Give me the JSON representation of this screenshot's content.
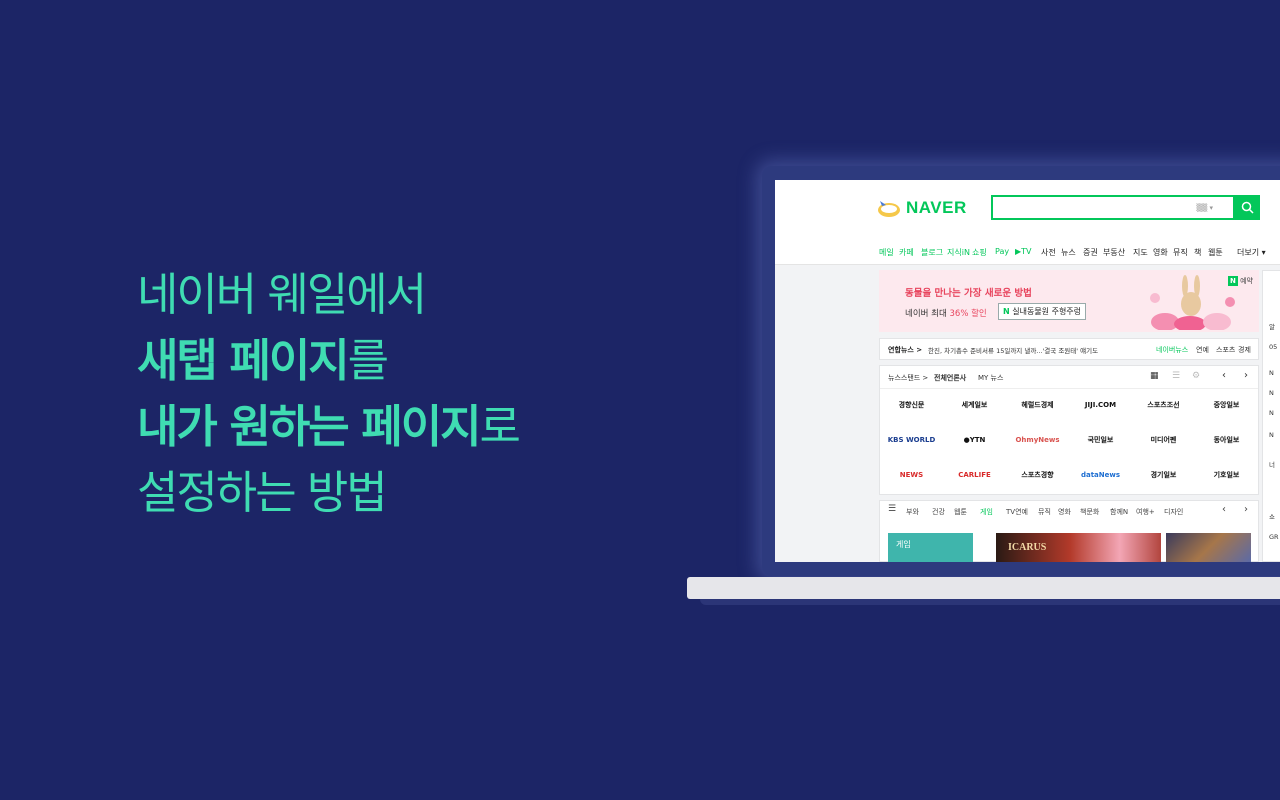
{
  "hero": {
    "line1": "네이버 웨일에서",
    "line2_bold": "새탭 페이지",
    "line2_rest": "를",
    "line3_bold": "내가 원하는 페이지",
    "line3_rest": "로",
    "line4": "설정하는 방법"
  },
  "naver": {
    "logo": "NAVER",
    "search_kb": "▒▒ ▾",
    "menu": [
      {
        "label": "메일",
        "green": true
      },
      {
        "label": "카페",
        "green": true
      },
      {
        "label": "블로그",
        "green": true
      },
      {
        "label": "지식iN",
        "green": true
      },
      {
        "label": "쇼핑",
        "green": true
      },
      {
        "label": "Pay",
        "green": true
      },
      {
        "label": "▶TV",
        "green": true
      },
      {
        "label": "사전",
        "green": false
      },
      {
        "label": "뉴스",
        "green": false
      },
      {
        "label": "증권",
        "green": false
      },
      {
        "label": "부동산",
        "green": false
      },
      {
        "label": "지도",
        "green": false
      },
      {
        "label": "영화",
        "green": false
      },
      {
        "label": "뮤직",
        "green": false
      },
      {
        "label": "책",
        "green": false
      },
      {
        "label": "웹툰",
        "green": false
      },
      {
        "label": "더보기 ▾",
        "green": false
      }
    ],
    "banner": {
      "title": "동물을 만나는 가장 새로운 방법",
      "sub_pre": "네이버 최대 ",
      "sub_pct": "36% 할인",
      "cta_n": "N",
      "cta": " 실내동물원 주형주렁",
      "ad_n": "N",
      "ad": " 예약"
    },
    "ticker": {
      "source": "연합뉴스 >",
      "headline": "한진, 차기총수 준비서류 15일까지 낼까...'결국 조원태' 얘기도",
      "links": [
        {
          "label": "네이버뉴스",
          "green": true
        },
        {
          "label": "연예",
          "green": false
        },
        {
          "label": "스포츠",
          "green": false
        },
        {
          "label": "경제",
          "green": false
        }
      ]
    },
    "newsstand": {
      "title": "뉴스스탠드 >",
      "all": "전체언론사",
      "my": "MY 뉴스",
      "press": [
        "경향신문",
        "세계일보",
        "헤럴드경제",
        "JIJI.COM",
        "스포츠조선",
        "중앙일보",
        "KBS WORLD",
        "●YTN",
        "OhmyNews",
        "국민일보",
        "미디어펜",
        "동아일보",
        "NEWS",
        "CARLIFE",
        "스포츠경향",
        "dataNews",
        "경기일보",
        "기호일보"
      ]
    },
    "tabs": [
      {
        "label": "부와",
        "green": false
      },
      {
        "label": "건강",
        "green": false
      },
      {
        "label": "웹툰",
        "green": false
      },
      {
        "label": "게임",
        "green": true
      },
      {
        "label": "TV연예",
        "green": false
      },
      {
        "label": "뮤직",
        "green": false
      },
      {
        "label": "영화",
        "green": false
      },
      {
        "label": "책문화",
        "green": false
      },
      {
        "label": "함께N",
        "green": false
      },
      {
        "label": "여행+",
        "green": false
      },
      {
        "label": "디자인",
        "green": false
      }
    ],
    "thumb_label": "게임",
    "thumb_title": "ICARUS",
    "rcol": [
      "알",
      "05",
      "N",
      "N",
      "N",
      "N",
      "너",
      "쇼",
      "GR"
    ]
  }
}
